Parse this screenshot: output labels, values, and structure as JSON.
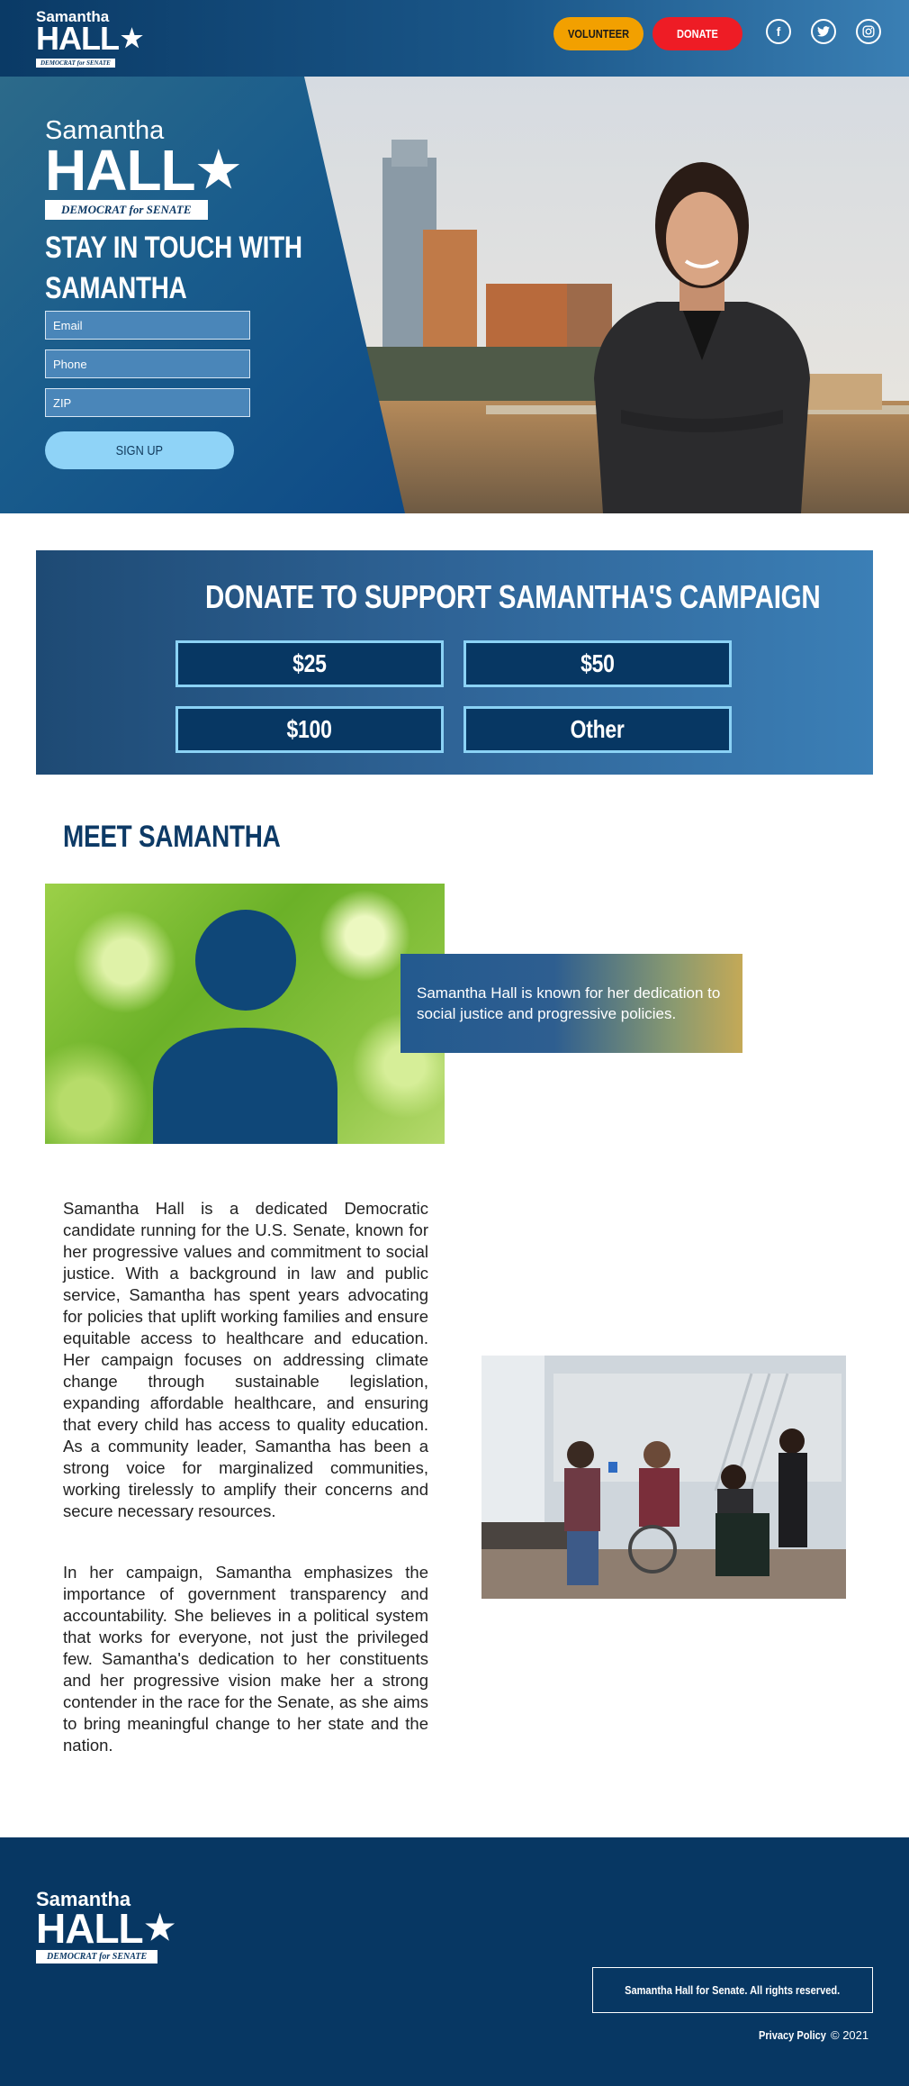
{
  "header": {
    "logo": {
      "first_name": "Samantha",
      "last_name": "HALL",
      "tagline": "DEMOCRAT for SENATE"
    },
    "volunteer_label": "VOLUNTEER",
    "donate_label": "DONATE",
    "social_icons": [
      "facebook-icon",
      "twitter-icon",
      "instagram-icon"
    ],
    "colors": {
      "volunteer": "#f2a000",
      "donate": "#ee1c25"
    }
  },
  "hero": {
    "logo": {
      "first_name": "Samantha",
      "last_name": "HALL",
      "tagline": "DEMOCRAT for SENATE"
    },
    "heading_line1": "STAY IN TOUCH WITH",
    "heading_line2": "SAMANTHA",
    "email_placeholder": "Email",
    "phone_placeholder": "Phone",
    "zip_placeholder": "ZIP",
    "signup_label": "SIGN UP"
  },
  "donate": {
    "heading": "DONATE TO SUPPORT SAMANTHA'S CAMPAIGN",
    "amounts": [
      "$25",
      "$50",
      "$100",
      "Other"
    ]
  },
  "meet": {
    "heading": "MEET SAMANTHA",
    "quote": "Samantha Hall is known for her dedication to social justice and progressive policies.",
    "bio_p1": "Samantha Hall is a dedicated Democratic candidate running for the U.S. Senate, known for her progressive values and commitment to social justice. With a background in law and public service, Samantha has spent years advocating for policies that uplift working families and ensure equitable access to healthcare and education. Her campaign focuses on addressing climate change through sustainable legislation, expanding affordable healthcare, and ensuring that every child has access to quality education. As a community leader, Samantha has been a strong voice for marginalized communities, working tirelessly to amplify their concerns and secure necessary resources.",
    "bio_p2": "In her campaign, Samantha emphasizes the importance of government transparency and accountability. She believes in a political system that works for everyone, not just the privileged few. Samantha's dedication to her constituents and her progressive vision make her a strong contender in the race for the Senate, as she aims to bring meaningful change to her state and the nation."
  },
  "footer": {
    "logo": {
      "first_name": "Samantha",
      "last_name": "HALL",
      "tagline": "DEMOCRAT for SENATE"
    },
    "copyright_box": "Samantha Hall for Senate. All rights reserved.",
    "privacy_label": "Privacy Policy",
    "year_label": "© 2021"
  }
}
